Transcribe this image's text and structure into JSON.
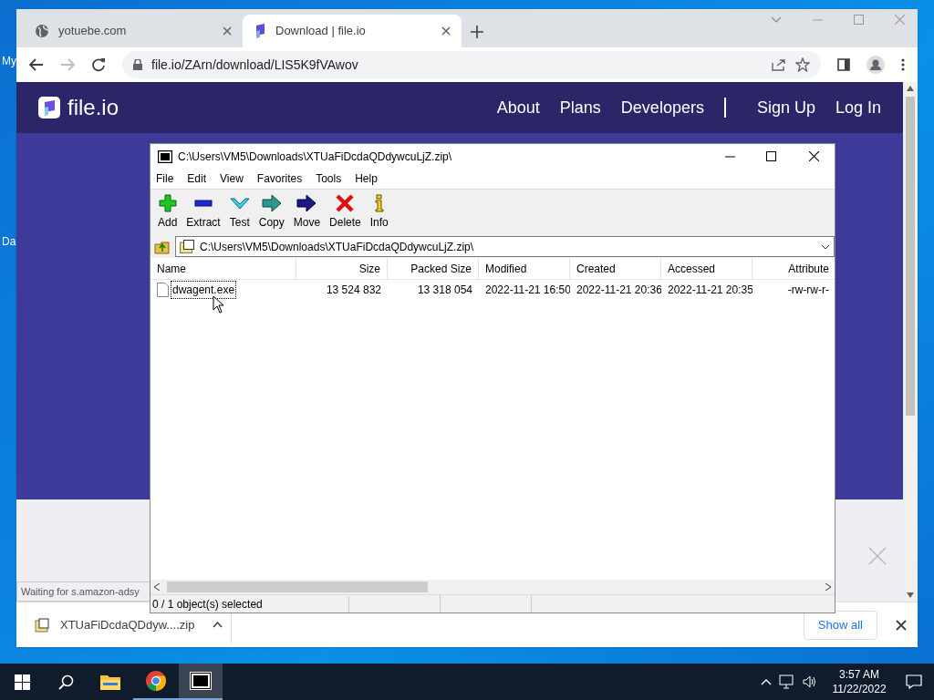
{
  "desktop_icons": [
    {
      "label": "My"
    },
    {
      "label": "Da"
    }
  ],
  "browser": {
    "tabs": [
      {
        "title": "yotuebe.com",
        "selected": false
      },
      {
        "title": "Download | file.io",
        "selected": true
      }
    ],
    "url": "file.io/ZArn/download/LIS5K9fVAwov",
    "site": {
      "logo": "file.io",
      "nav": [
        "About",
        "Plans",
        "Developers",
        "Sign Up",
        "Log In"
      ]
    },
    "loading_status": "Waiting for s.amazon-adsy",
    "downloads": {
      "file": "XTUaFiDcdaQDdyw....zip",
      "show_all": "Show all"
    }
  },
  "archive_window": {
    "title": "C:\\Users\\VM5\\Downloads\\XTUaFiDcdaQDdywcuLjZ.zip\\",
    "menu": [
      "File",
      "Edit",
      "View",
      "Favorites",
      "Tools",
      "Help"
    ],
    "toolbar": [
      {
        "label": "Add",
        "kind": "add"
      },
      {
        "label": "Extract",
        "kind": "extract"
      },
      {
        "label": "Test",
        "kind": "test"
      },
      {
        "label": "Copy",
        "kind": "copy"
      },
      {
        "label": "Move",
        "kind": "move"
      },
      {
        "label": "Delete",
        "kind": "delete"
      },
      {
        "label": "Info",
        "kind": "info"
      }
    ],
    "path": "C:\\Users\\VM5\\Downloads\\XTUaFiDcdaQDdywcuLjZ.zip\\",
    "columns": [
      "Name",
      "Size",
      "Packed Size",
      "Modified",
      "Created",
      "Accessed",
      "Attribute"
    ],
    "rows": [
      {
        "cells": [
          "dwagent.exe",
          "13 524 832",
          "13 318 054",
          "2022-11-21 16:50",
          "2022-11-21 20:36",
          "2022-11-21 20:35",
          "-rw-rw-r-"
        ]
      }
    ],
    "status": "0 / 1 object(s) selected"
  },
  "taskbar": {
    "time": "3:57 AM",
    "date": "11/22/2022"
  }
}
